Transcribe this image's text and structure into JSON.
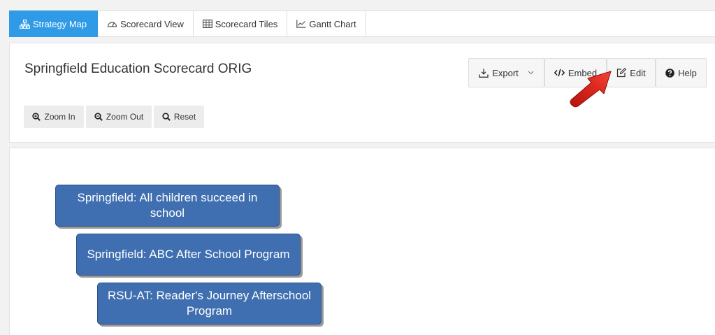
{
  "tabs": [
    {
      "label": "Strategy Map",
      "icon": "sitemap-icon",
      "active": true
    },
    {
      "label": "Scorecard View",
      "icon": "dashboard-icon",
      "active": false
    },
    {
      "label": "Scorecard Tiles",
      "icon": "table-icon",
      "active": false
    },
    {
      "label": "Gantt Chart",
      "icon": "line-chart-icon",
      "active": false
    }
  ],
  "header": {
    "title": "Springfield Education Scorecard ORIG",
    "actions": {
      "export": "Export",
      "embed": "Embed",
      "edit": "Edit",
      "help": "Help"
    },
    "zoom": {
      "zoom_in": "Zoom In",
      "zoom_out": "Zoom Out",
      "reset": "Reset"
    }
  },
  "map": {
    "nodes": [
      {
        "label": "Springfield: All children succeed in school"
      },
      {
        "label": "Springfield: ABC After School Program"
      },
      {
        "label": "RSU-AT: Reader's Journey Afterschool Program"
      }
    ]
  },
  "colors": {
    "active_tab": "#2f9ae6",
    "node_fill": "#3f6fb0",
    "annotation_arrow": "#d9261c"
  }
}
